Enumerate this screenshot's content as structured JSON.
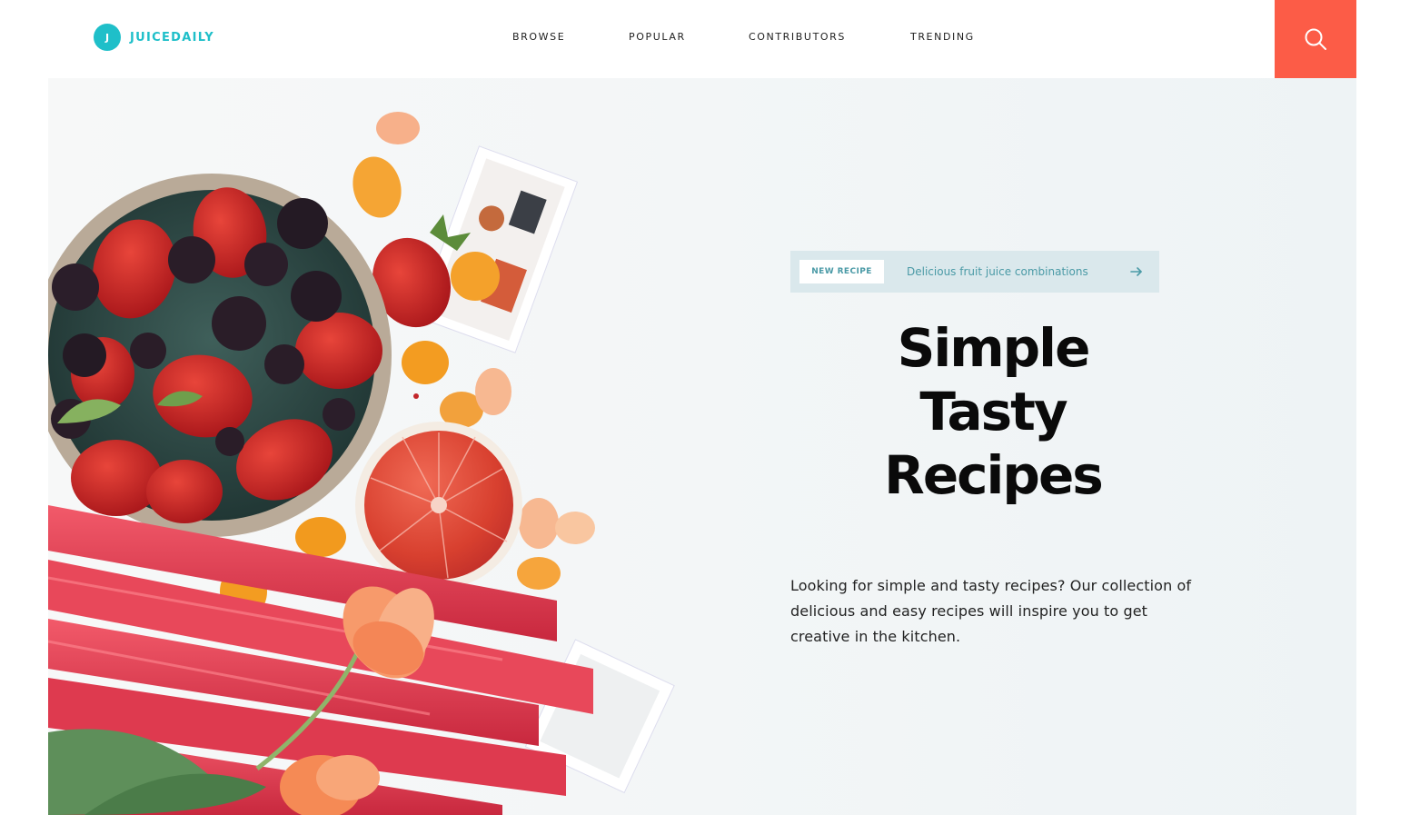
{
  "colors": {
    "brand": "#1fbfc9",
    "accent": "#fc5c47",
    "badge_bg": "#dae8ec",
    "badge_text": "#4a9aa6"
  },
  "header": {
    "logo_letter": "J",
    "logo_text": "JUICEDAILY",
    "nav": [
      {
        "label": "BROWSE"
      },
      {
        "label": "POPULAR"
      },
      {
        "label": "CONTRIBUTORS"
      },
      {
        "label": "TRENDING"
      }
    ],
    "search_icon": "search-icon"
  },
  "hero": {
    "badge": {
      "tag": "NEW RECIPE",
      "text": "Delicious fruit juice combinations",
      "icon": "arrow-right-icon"
    },
    "title_lines": [
      "Simple",
      "Tasty",
      "Recipes"
    ],
    "description": "Looking for simple and tasty recipes? Our collection of delicious and easy recipes will inspire you to get creative in the kitchen."
  }
}
